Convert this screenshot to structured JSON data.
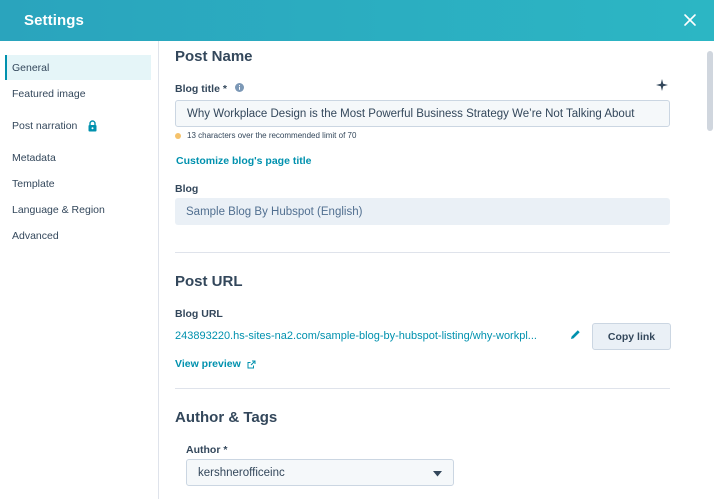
{
  "header": {
    "title": "Settings",
    "close_icon": "close-icon",
    "gradient": [
      "#2aa4bd",
      "#2cb6c4"
    ]
  },
  "sidebar": {
    "items": [
      {
        "label": "General",
        "active": true
      },
      {
        "label": "Featured image"
      },
      {
        "label": "Post narration",
        "icon": "lock-icon"
      },
      {
        "label": "Metadata"
      },
      {
        "label": "Template"
      },
      {
        "label": "Language & Region"
      },
      {
        "label": "Advanced"
      }
    ]
  },
  "post_name": {
    "heading": "Post Name",
    "blog_title_label": "Blog title *",
    "blog_title_value": "Why Workplace Design is the Most Powerful Business Strategy We’re Not Talking About",
    "warning": "13 characters over the recommended limit of 70",
    "customize_link": "Customize blog's page title",
    "blog_label": "Blog",
    "blog_value": "Sample Blog By Hubspot (English)"
  },
  "post_url": {
    "heading": "Post URL",
    "blog_url_label": "Blog URL",
    "blog_url_value": "243893220.hs-sites-na2.com/sample-blog-by-hubspot-listing/why-workpl...",
    "copy_label": "Copy link",
    "view_preview": "View preview"
  },
  "author_tags": {
    "heading": "Author & Tags",
    "author_label": "Author *",
    "author_value": "kershnerofficeinc"
  },
  "colors": {
    "accent": "#0091ae",
    "text": "#33475b",
    "warning_dot": "#f5c26b"
  }
}
